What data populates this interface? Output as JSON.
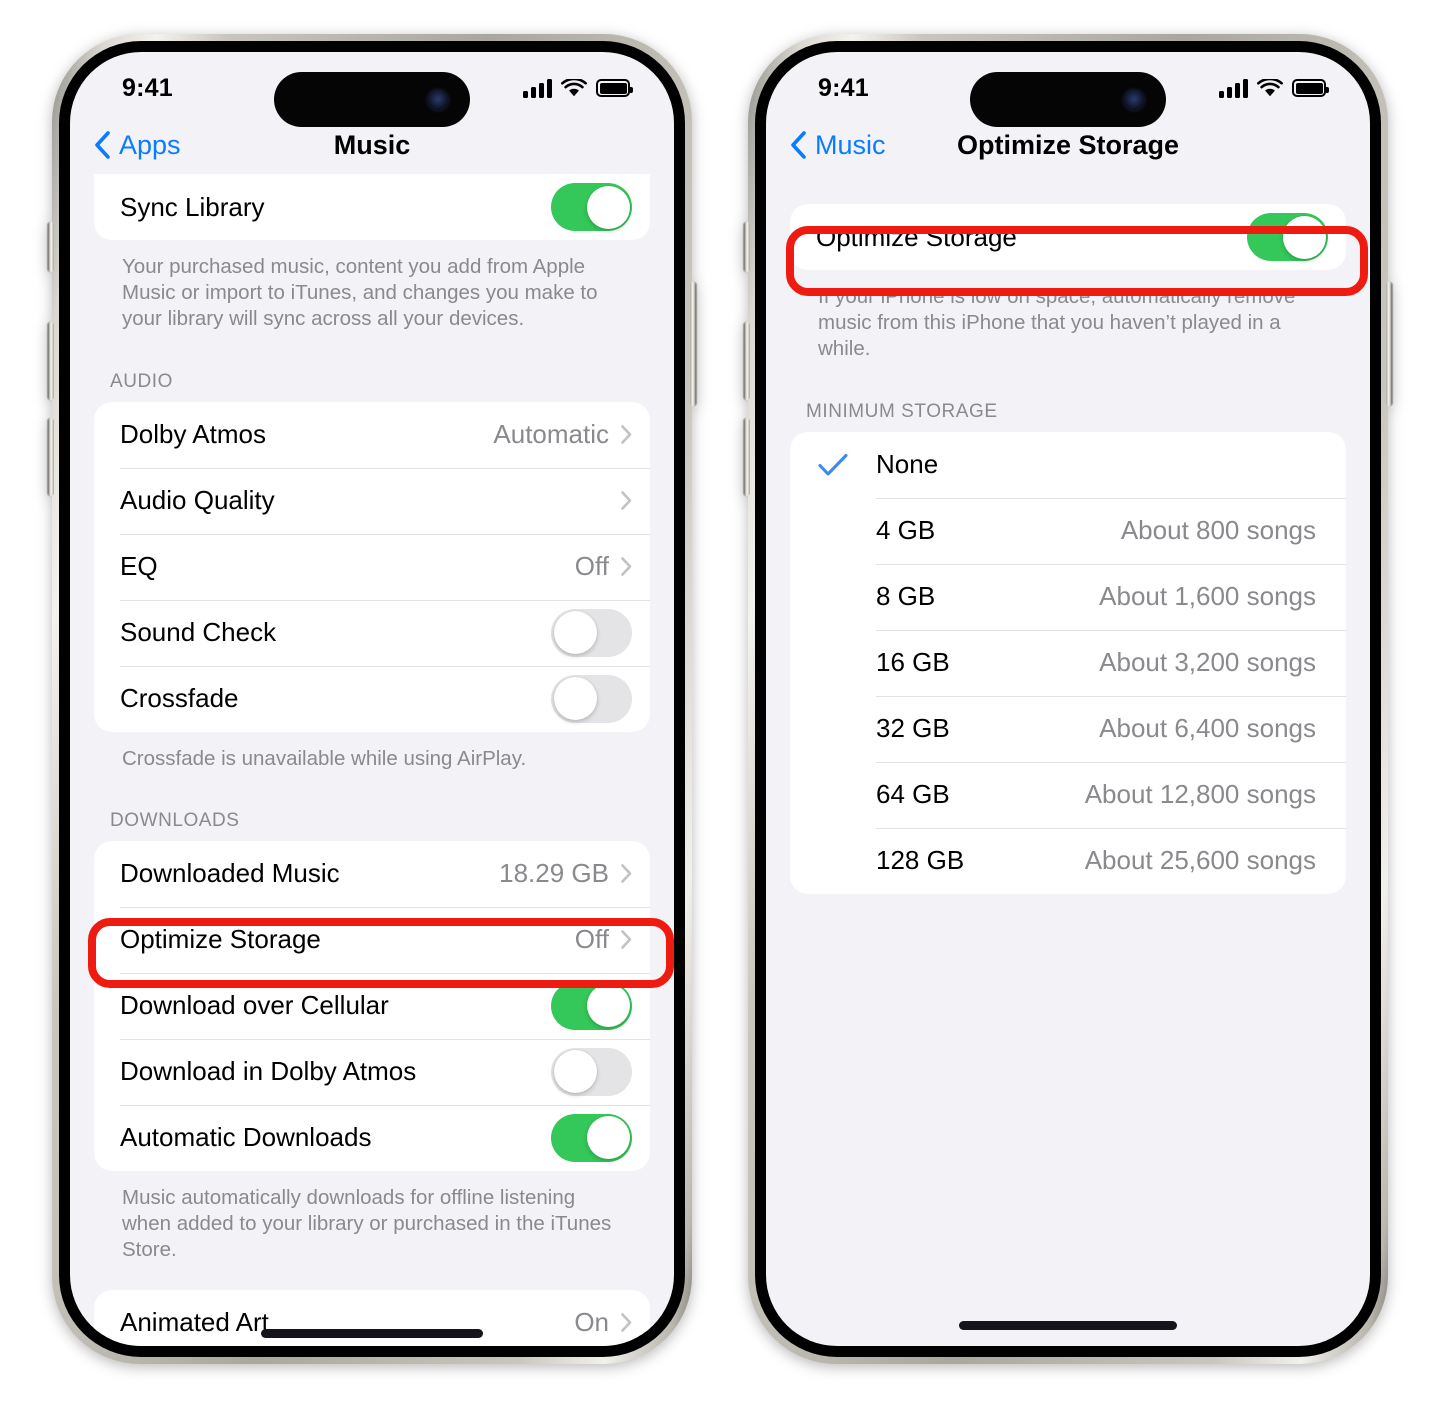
{
  "screens": [
    {
      "id": "music-settings",
      "status_bar": {
        "time": "9:41",
        "cellular": "signal-bars-icon",
        "wifi": "wifi-icon",
        "battery": "battery-full-icon"
      },
      "nav": {
        "back_label": "Apps",
        "title": "Music"
      },
      "rows_top": [
        {
          "label": "Sync Library",
          "type": "toggle",
          "value": "on"
        }
      ],
      "footnote_top": "Your purchased music, content you add from Apple Music or import to iTunes, and changes you make to your library will sync across all your devices.",
      "section_audio": "AUDIO",
      "rows_audio": [
        {
          "label": "Dolby Atmos",
          "type": "disclosure",
          "value": "Automatic"
        },
        {
          "label": "Audio Quality",
          "type": "disclosure",
          "value": ""
        },
        {
          "label": "EQ",
          "type": "disclosure",
          "value": "Off"
        },
        {
          "label": "Sound Check",
          "type": "toggle",
          "value": "off"
        },
        {
          "label": "Crossfade",
          "type": "toggle",
          "value": "off"
        }
      ],
      "footnote_audio": "Crossfade is unavailable while using AirPlay.",
      "section_downloads": "DOWNLOADS",
      "rows_downloads": [
        {
          "label": "Downloaded Music",
          "type": "disclosure",
          "value": "18.29 GB"
        },
        {
          "label": "Optimize Storage",
          "type": "disclosure",
          "value": "Off",
          "highlighted": "true"
        },
        {
          "label": "Download over Cellular",
          "type": "toggle",
          "value": "on"
        },
        {
          "label": "Download in Dolby Atmos",
          "type": "toggle",
          "value": "off"
        },
        {
          "label": "Automatic Downloads",
          "type": "toggle",
          "value": "on"
        }
      ],
      "footnote_downloads": "Music automatically downloads for offline listening when added to your library or purchased in the iTunes Store.",
      "rows_bottom": [
        {
          "label": "Animated Art",
          "type": "disclosure",
          "value": "On"
        }
      ]
    },
    {
      "id": "optimize-storage",
      "status_bar": {
        "time": "9:41",
        "cellular": "signal-bars-icon",
        "wifi": "wifi-icon",
        "battery": "battery-full-icon"
      },
      "nav": {
        "back_label": "Music",
        "title": "Optimize Storage"
      },
      "rows_top": [
        {
          "label": "Optimize Storage",
          "type": "toggle",
          "value": "on",
          "highlighted": "true"
        }
      ],
      "footnote_top": "If your iPhone is low on space, automatically remove music from this iPhone that you haven’t played in a while.",
      "section_minimum": "MINIMUM STORAGE",
      "rows_minimum": [
        {
          "label": "None",
          "value": "",
          "selected": "true"
        },
        {
          "label": "4 GB",
          "value": "About 800 songs",
          "selected": "false"
        },
        {
          "label": "8 GB",
          "value": "About 1,600 songs",
          "selected": "false"
        },
        {
          "label": "16 GB",
          "value": "About 3,200 songs",
          "selected": "false"
        },
        {
          "label": "32 GB",
          "value": "About 6,400 songs",
          "selected": "false"
        },
        {
          "label": "64 GB",
          "value": "About 12,800 songs",
          "selected": "false"
        },
        {
          "label": "128 GB",
          "value": "About 25,600 songs",
          "selected": "false"
        }
      ]
    }
  ],
  "colors": {
    "accent_blue": "#0a7cff",
    "toggle_green": "#34c759",
    "highlight_red": "#ee1b11",
    "secondary_text": "#8a8a8e",
    "group_background": "#f2f2f7"
  }
}
